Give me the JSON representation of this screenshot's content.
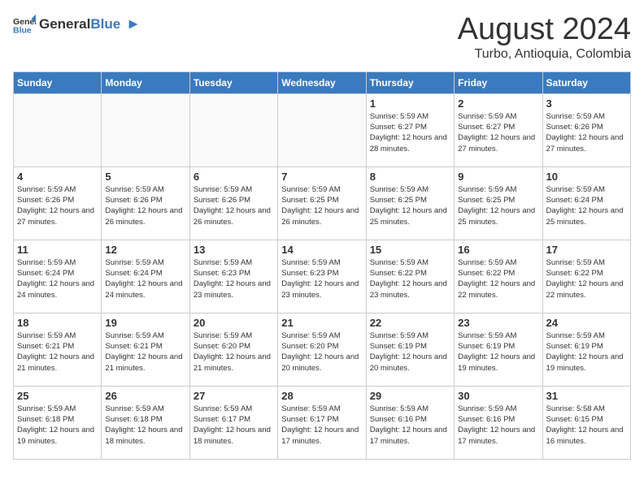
{
  "header": {
    "logo_general": "General",
    "logo_blue": "Blue",
    "month_year": "August 2024",
    "location": "Turbo, Antioquia, Colombia"
  },
  "days_of_week": [
    "Sunday",
    "Monday",
    "Tuesday",
    "Wednesday",
    "Thursday",
    "Friday",
    "Saturday"
  ],
  "weeks": [
    [
      {
        "day": "",
        "info": ""
      },
      {
        "day": "",
        "info": ""
      },
      {
        "day": "",
        "info": ""
      },
      {
        "day": "",
        "info": ""
      },
      {
        "day": "1",
        "info": "Sunrise: 5:59 AM\nSunset: 6:27 PM\nDaylight: 12 hours\nand 28 minutes."
      },
      {
        "day": "2",
        "info": "Sunrise: 5:59 AM\nSunset: 6:27 PM\nDaylight: 12 hours\nand 27 minutes."
      },
      {
        "day": "3",
        "info": "Sunrise: 5:59 AM\nSunset: 6:26 PM\nDaylight: 12 hours\nand 27 minutes."
      }
    ],
    [
      {
        "day": "4",
        "info": "Sunrise: 5:59 AM\nSunset: 6:26 PM\nDaylight: 12 hours\nand 27 minutes."
      },
      {
        "day": "5",
        "info": "Sunrise: 5:59 AM\nSunset: 6:26 PM\nDaylight: 12 hours\nand 26 minutes."
      },
      {
        "day": "6",
        "info": "Sunrise: 5:59 AM\nSunset: 6:26 PM\nDaylight: 12 hours\nand 26 minutes."
      },
      {
        "day": "7",
        "info": "Sunrise: 5:59 AM\nSunset: 6:25 PM\nDaylight: 12 hours\nand 26 minutes."
      },
      {
        "day": "8",
        "info": "Sunrise: 5:59 AM\nSunset: 6:25 PM\nDaylight: 12 hours\nand 25 minutes."
      },
      {
        "day": "9",
        "info": "Sunrise: 5:59 AM\nSunset: 6:25 PM\nDaylight: 12 hours\nand 25 minutes."
      },
      {
        "day": "10",
        "info": "Sunrise: 5:59 AM\nSunset: 6:24 PM\nDaylight: 12 hours\nand 25 minutes."
      }
    ],
    [
      {
        "day": "11",
        "info": "Sunrise: 5:59 AM\nSunset: 6:24 PM\nDaylight: 12 hours\nand 24 minutes."
      },
      {
        "day": "12",
        "info": "Sunrise: 5:59 AM\nSunset: 6:24 PM\nDaylight: 12 hours\nand 24 minutes."
      },
      {
        "day": "13",
        "info": "Sunrise: 5:59 AM\nSunset: 6:23 PM\nDaylight: 12 hours\nand 23 minutes."
      },
      {
        "day": "14",
        "info": "Sunrise: 5:59 AM\nSunset: 6:23 PM\nDaylight: 12 hours\nand 23 minutes."
      },
      {
        "day": "15",
        "info": "Sunrise: 5:59 AM\nSunset: 6:22 PM\nDaylight: 12 hours\nand 23 minutes."
      },
      {
        "day": "16",
        "info": "Sunrise: 5:59 AM\nSunset: 6:22 PM\nDaylight: 12 hours\nand 22 minutes."
      },
      {
        "day": "17",
        "info": "Sunrise: 5:59 AM\nSunset: 6:22 PM\nDaylight: 12 hours\nand 22 minutes."
      }
    ],
    [
      {
        "day": "18",
        "info": "Sunrise: 5:59 AM\nSunset: 6:21 PM\nDaylight: 12 hours\nand 21 minutes."
      },
      {
        "day": "19",
        "info": "Sunrise: 5:59 AM\nSunset: 6:21 PM\nDaylight: 12 hours\nand 21 minutes."
      },
      {
        "day": "20",
        "info": "Sunrise: 5:59 AM\nSunset: 6:20 PM\nDaylight: 12 hours\nand 21 minutes."
      },
      {
        "day": "21",
        "info": "Sunrise: 5:59 AM\nSunset: 6:20 PM\nDaylight: 12 hours\nand 20 minutes."
      },
      {
        "day": "22",
        "info": "Sunrise: 5:59 AM\nSunset: 6:19 PM\nDaylight: 12 hours\nand 20 minutes."
      },
      {
        "day": "23",
        "info": "Sunrise: 5:59 AM\nSunset: 6:19 PM\nDaylight: 12 hours\nand 19 minutes."
      },
      {
        "day": "24",
        "info": "Sunrise: 5:59 AM\nSunset: 6:19 PM\nDaylight: 12 hours\nand 19 minutes."
      }
    ],
    [
      {
        "day": "25",
        "info": "Sunrise: 5:59 AM\nSunset: 6:18 PM\nDaylight: 12 hours\nand 19 minutes."
      },
      {
        "day": "26",
        "info": "Sunrise: 5:59 AM\nSunset: 6:18 PM\nDaylight: 12 hours\nand 18 minutes."
      },
      {
        "day": "27",
        "info": "Sunrise: 5:59 AM\nSunset: 6:17 PM\nDaylight: 12 hours\nand 18 minutes."
      },
      {
        "day": "28",
        "info": "Sunrise: 5:59 AM\nSunset: 6:17 PM\nDaylight: 12 hours\nand 17 minutes."
      },
      {
        "day": "29",
        "info": "Sunrise: 5:59 AM\nSunset: 6:16 PM\nDaylight: 12 hours\nand 17 minutes."
      },
      {
        "day": "30",
        "info": "Sunrise: 5:59 AM\nSunset: 6:16 PM\nDaylight: 12 hours\nand 17 minutes."
      },
      {
        "day": "31",
        "info": "Sunrise: 5:58 AM\nSunset: 6:15 PM\nDaylight: 12 hours\nand 16 minutes."
      }
    ]
  ]
}
